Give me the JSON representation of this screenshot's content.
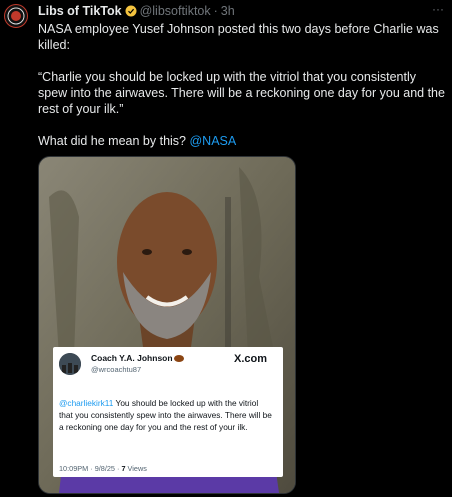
{
  "post": {
    "author_name": "Libs of TikTok",
    "handle": "@libsoftiktok",
    "separator": "·",
    "time": "3h",
    "more": "···",
    "text_line1": "NASA employee Yusef Johnson posted this two days before Charlie was killed:",
    "quote_text": "“Charlie you should be locked up with the vitriol that you consistently spew into the airwaves. There will be a reckoning one day for you and the rest of your ilk.”",
    "question": "What did he mean by this? ",
    "mention": "@NASA",
    "avatar_label": "Libs of TikTok"
  },
  "embedded": {
    "name": "Coach Y.A. Johnson",
    "handle": "@wrcoachtu87",
    "logo": "X.com",
    "mention": "@charliekirk11",
    "body": " You should be locked up with the vitriol that you consistently spew into the airwaves. There will be a reckoning one day for you and the rest of your ilk.",
    "meta_time": "10:09PM · 9/8/25 · ",
    "views_count": "7",
    "views_label": " Views"
  },
  "colors": {
    "background": "#000000",
    "text": "#e7e9ea",
    "secondary": "#71767b",
    "link": "#1d9bf0",
    "verified": "#f4c33f",
    "shirt": "#5b3aa6"
  }
}
